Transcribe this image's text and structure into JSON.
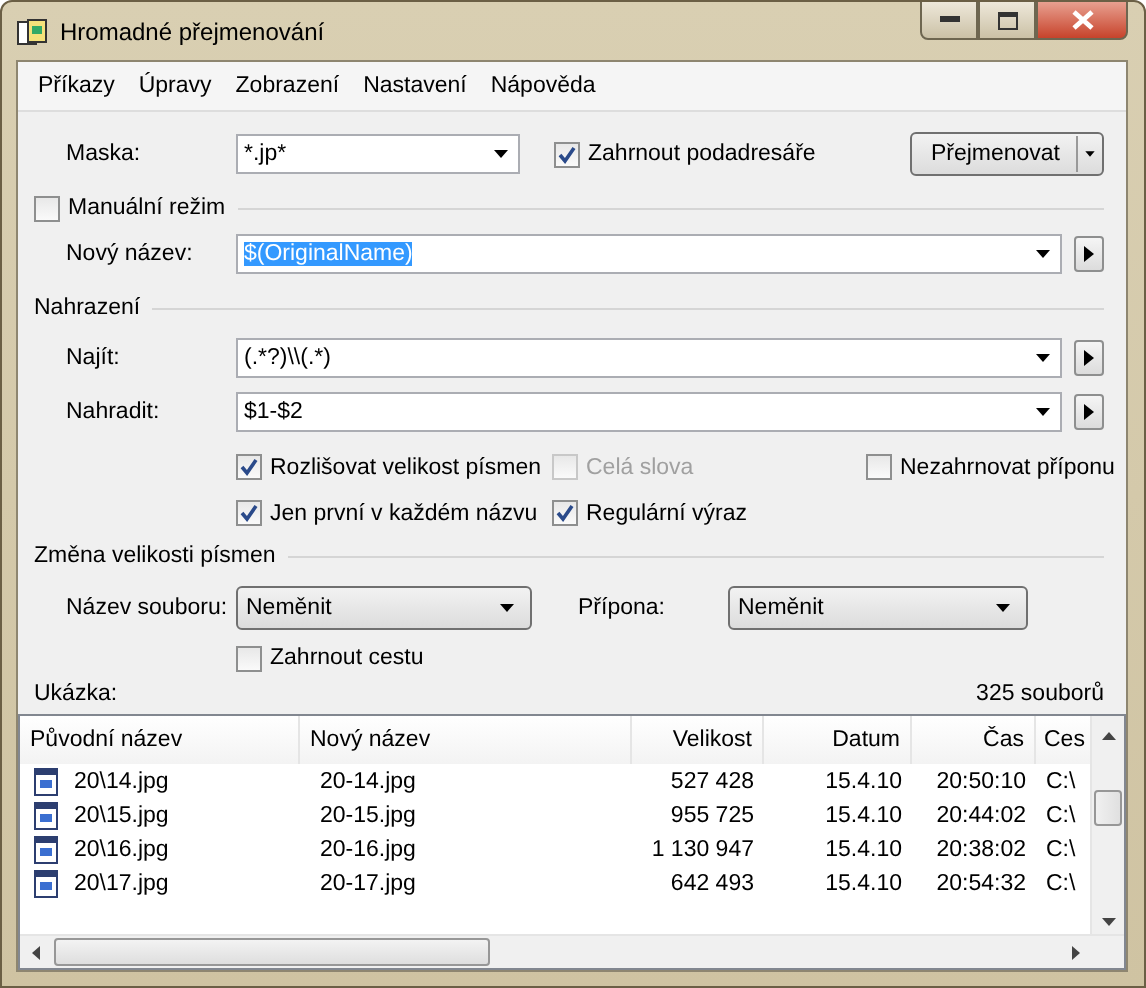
{
  "window": {
    "title": "Hromadné přejmenování"
  },
  "menu": [
    "Příkazy",
    "Úpravy",
    "Zobrazení",
    "Nastavení",
    "Nápověda"
  ],
  "mask": {
    "label": "Maska:",
    "value": "*.jp*"
  },
  "include_subdirs": {
    "label": "Zahrnout podadresáře",
    "checked": true
  },
  "rename_button": {
    "label": "Přejmenovat"
  },
  "manual_mode": {
    "label": "Manuální režim",
    "checked": false
  },
  "new_name": {
    "label": "Nový název:",
    "value": "$(OriginalName)",
    "highlighted": true
  },
  "replace": {
    "title": "Nahrazení",
    "find": {
      "label": "Najít:",
      "value": "(.*?)\\\\(.*)"
    },
    "replace_with": {
      "label": "Nahradit:",
      "value": "$1-$2"
    },
    "options": [
      {
        "label": "Rozlišovat velikost písmen",
        "checked": true,
        "disabled": false
      },
      {
        "label": "Celá slova",
        "checked": false,
        "disabled": true
      },
      {
        "label": "Nezahrnovat příponu",
        "checked": false,
        "disabled": false
      },
      {
        "label": "Jen první v každém názvu",
        "checked": true,
        "disabled": false
      },
      {
        "label": "Regulární výraz",
        "checked": true,
        "disabled": false
      }
    ]
  },
  "case_change": {
    "title": "Změna velikosti písmen",
    "filename": {
      "label": "Název souboru:",
      "value": "Neměnit"
    },
    "extension": {
      "label": "Přípona:",
      "value": "Neměnit"
    },
    "include_path": {
      "label": "Zahrnout cestu",
      "checked": false
    }
  },
  "preview": {
    "label": "Ukázka:",
    "count": "325 souborů"
  },
  "table": {
    "columns": [
      "Původní název",
      "Nový název",
      "Velikost",
      "Datum",
      "Čas",
      "Ces"
    ],
    "rows": [
      [
        "20\\14.jpg",
        "20-14.jpg",
        "527 428",
        "15.4.10",
        "20:50:10",
        "C:\\"
      ],
      [
        "20\\15.jpg",
        "20-15.jpg",
        "955 725",
        "15.4.10",
        "20:44:02",
        "C:\\"
      ],
      [
        "20\\16.jpg",
        "20-16.jpg",
        "1 130 947",
        "15.4.10",
        "20:38:02",
        "C:\\"
      ],
      [
        "20\\17.jpg",
        "20-17.jpg",
        "642 493",
        "15.4.10",
        "20:54:32",
        "C:\\"
      ]
    ]
  }
}
